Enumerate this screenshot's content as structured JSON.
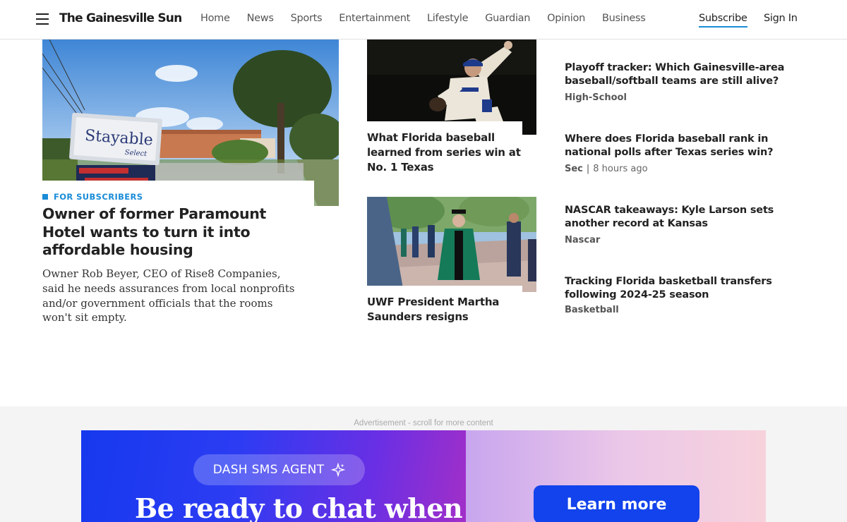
{
  "header": {
    "brand": "The Gainesville Sun",
    "nav": [
      "Home",
      "News",
      "Sports",
      "Entertainment",
      "Lifestyle",
      "Guardian",
      "Opinion",
      "Business"
    ],
    "subscribe": "Subscribe",
    "sign_in": "Sign In",
    "accent_color": "#1a8cd8"
  },
  "lead": {
    "image_sign_text": "Stayable",
    "image_sign_subtext": "Select",
    "badge": "FOR SUBSCRIBERS",
    "title": "Owner of former Paramount Hotel wants to turn it into affordable housing",
    "summary": "Owner Rob Beyer, CEO of Rise8 Companies, said he needs assurances from local nonprofits and/or government officials that the rooms won't sit empty."
  },
  "middle": [
    {
      "title": "What Florida baseball learned from series win at No. 1 Texas"
    },
    {
      "title": "UWF President Martha Saunders resigns"
    }
  ],
  "right_list": [
    {
      "title": "Playoff tracker: Which Gainesville-area baseball/softball teams are still alive?",
      "category": "High-School",
      "time": ""
    },
    {
      "title": "Where does Florida baseball rank in national polls after Texas series win?",
      "category": "Sec",
      "time": "8 hours ago"
    },
    {
      "title": "NASCAR takeaways: Kyle Larson sets another record at Kansas",
      "category": "Nascar",
      "time": ""
    },
    {
      "title": "Tracking Florida basketball transfers following 2024-25 season",
      "category": "Basketball",
      "time": ""
    }
  ],
  "ad": {
    "label": "Advertisement - scroll for more content",
    "pill": "DASH SMS AGENT",
    "headline": "Be ready to chat when",
    "button": "Learn more"
  }
}
